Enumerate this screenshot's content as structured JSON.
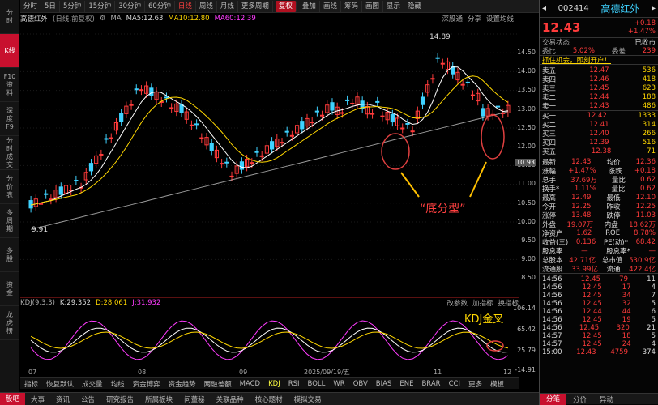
{
  "left_sidebar": [
    {
      "label": "分时",
      "active": false
    },
    {
      "label": "K线",
      "active": true
    },
    {
      "label": "F10资料",
      "active": false
    },
    {
      "label": "深度F9",
      "active": false
    },
    {
      "label": "分时成交",
      "active": false
    },
    {
      "label": "分价表",
      "active": false
    },
    {
      "label": "多周期",
      "active": false
    },
    {
      "label": "多股",
      "active": false
    },
    {
      "label": "资金",
      "active": false
    },
    {
      "label": "龙虎榜",
      "active": false
    }
  ],
  "toolbar": {
    "items": [
      "分时",
      "5日",
      "5分钟",
      "15分钟",
      "30分钟",
      "60分钟",
      "日线",
      "周线",
      "月线",
      "更多周期",
      "复权",
      "叠加",
      "画线",
      "筹码",
      "画图",
      "显示",
      "隐藏"
    ],
    "active": "日线",
    "fuquan_label": "复权",
    "settings": "设置",
    "collapse": "隐藏"
  },
  "legend": {
    "stock": "高德红外",
    "mode": "(日线,前复权)",
    "ma_label": "MA",
    "ma5": "MA5:12.63",
    "ma10": "MA10:12.80",
    "ma60": "MA60:12.39",
    "links": [
      "深股通",
      "分享",
      "设置均线"
    ]
  },
  "chart_price_axis": {
    "ticks": [
      "14.50",
      "14.00",
      "13.50",
      "13.00",
      "12.50",
      "12.00",
      "11.50",
      "11.00",
      "10.50",
      "10.00",
      "9.50",
      "9.00",
      "8.50"
    ],
    "current_price": "10.93",
    "kdj_ticks": [
      "106.14",
      "65.42",
      "25.79",
      "-14.91"
    ]
  },
  "chart_annotations": {
    "high": "14.89",
    "low": "9.91",
    "bottom_pattern": "“底分型”",
    "kdj_cross": "KDJ金叉"
  },
  "kdj_legend": {
    "name": "KDJ(9,3,3)",
    "k": "K:29.352",
    "d": "D:28.061",
    "j": "J:31.932",
    "links": [
      "改参数",
      "加指标",
      "换指标"
    ]
  },
  "date_axis": {
    "labels": [
      "07",
      "08",
      "09",
      "2025/09/19/五",
      "11",
      "12"
    ]
  },
  "bottom_tabs": {
    "items": [
      "指标",
      "恢复默认",
      "成交量",
      "均线",
      "资金博弈",
      "资金趋势",
      "两融差额",
      "MACD",
      "KDJ",
      "RSI",
      "BOLL",
      "WR",
      "OBV",
      "BIAS",
      "ENE",
      "BRAR",
      "CCI",
      "更多",
      "模板"
    ],
    "active": "KDJ"
  },
  "footer_tabs": {
    "items": [
      "股吧",
      "大事",
      "资讯",
      "公告",
      "研究报告",
      "所属板块",
      "问董秘",
      "关联品种",
      "核心题材",
      "模拟交易"
    ],
    "active": "股吧"
  },
  "quote": {
    "code": "002414",
    "name": "高德红外",
    "price": "12.43",
    "change": "+0.18",
    "change_pct": "+1.47%",
    "title": "交易状态",
    "status": "已收市",
    "weibi_label": "委比",
    "weibi": "5.02%",
    "weicha_label": "委差",
    "weicha": "239",
    "promo": "抓住机会，即刻开户！",
    "asks": [
      {
        "label": "卖五",
        "price": "12.47",
        "vol": "536"
      },
      {
        "label": "卖四",
        "price": "12.46",
        "vol": "418"
      },
      {
        "label": "卖三",
        "price": "12.45",
        "vol": "623"
      },
      {
        "label": "卖二",
        "price": "12.44",
        "vol": "188"
      },
      {
        "label": "卖一",
        "price": "12.43",
        "vol": "486"
      }
    ],
    "bids": [
      {
        "label": "买一",
        "price": "12.42",
        "vol": "1333"
      },
      {
        "label": "买二",
        "price": "12.41",
        "vol": "314"
      },
      {
        "label": "买三",
        "price": "12.40",
        "vol": "266"
      },
      {
        "label": "买四",
        "price": "12.39",
        "vol": "516"
      },
      {
        "label": "买五",
        "price": "12.38",
        "vol": "71"
      }
    ],
    "stats": [
      [
        "最新",
        "12.43",
        "均价",
        "12.36"
      ],
      [
        "涨幅",
        "+1.47%",
        "涨跌",
        "+0.18"
      ],
      [
        "总手",
        "37.69万",
        "量比",
        "0.62"
      ],
      [
        "换手*",
        "1.11%",
        "量比",
        "0.62"
      ],
      [
        "最高",
        "12.49",
        "最低",
        "12.10"
      ],
      [
        "今开",
        "12.25",
        "昨收",
        "12.25"
      ],
      [
        "涨停",
        "13.48",
        "跌停",
        "11.03"
      ],
      [
        "外盘",
        "19.07万",
        "内盘",
        "18.62万"
      ],
      [
        "净资产",
        "1.62",
        "ROE",
        "8.78%"
      ],
      [
        "收益(三)",
        "0.136",
        "PE(动)*",
        "68.42"
      ],
      [
        "股息率",
        "—",
        "股息率*",
        "—"
      ],
      [
        "总股本",
        "42.71亿",
        "总市值",
        "530.9亿"
      ],
      [
        "流通股",
        "33.99亿",
        "流通",
        "422.4亿"
      ]
    ]
  },
  "ticks": [
    [
      "14:56",
      "12.45",
      "79",
      "11"
    ],
    [
      "14:56",
      "12.45",
      "17",
      "4"
    ],
    [
      "14:56",
      "12.45",
      "34",
      "7"
    ],
    [
      "14:56",
      "12.45",
      "32",
      "5"
    ],
    [
      "14:56",
      "12.44",
      "44",
      "6"
    ],
    [
      "14:56",
      "12.45",
      "19",
      "5"
    ],
    [
      "14:56",
      "12.45",
      "320",
      "21"
    ],
    [
      "14:57",
      "12.45",
      "18",
      "5"
    ],
    [
      "14:57",
      "12.45",
      "24",
      "4"
    ],
    [
      "15:00",
      "12.43",
      "4759",
      "374"
    ]
  ],
  "panel_tabs": {
    "items": [
      "分笔",
      "分价",
      "异动"
    ],
    "active": "分笔"
  }
}
